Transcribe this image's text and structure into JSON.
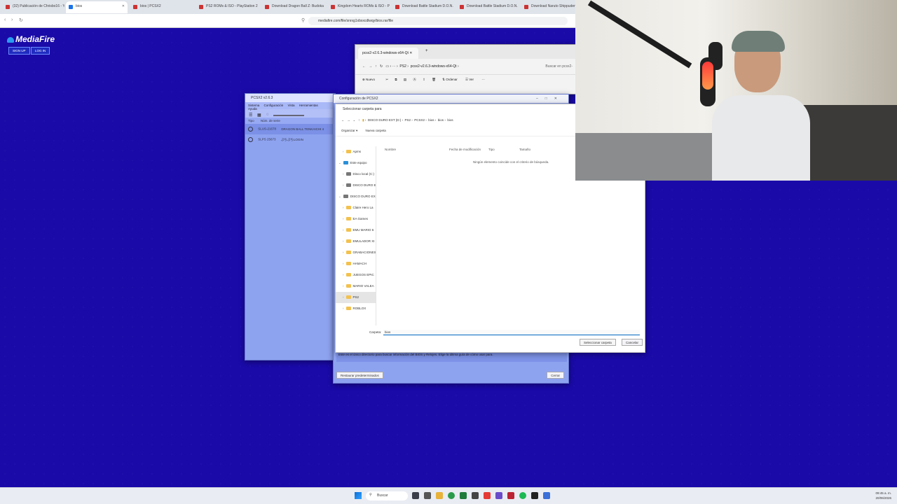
{
  "browser": {
    "tabs": [
      {
        "label": "(32) Publicación de Chrisbo16 - YouT",
        "active": false
      },
      {
        "label": "bios",
        "active": true
      },
      {
        "label": "bios | PCSX2",
        "active": false
      },
      {
        "label": "PS2 ROMs & ISO - PlayStation 2 Gam",
        "active": false
      },
      {
        "label": "Download Dragon Ball Z: Budokai Te",
        "active": false
      },
      {
        "label": "Kingdom Hearts ROMs & ISO - PS2 G",
        "active": false
      },
      {
        "label": "Download Battle Stadium D.O.N. ROM",
        "active": false
      },
      {
        "label": "Download Battle Stadium D.O.N. ROM",
        "active": false
      },
      {
        "label": "Download Naruto Shippuden Ultim",
        "active": false
      }
    ],
    "url": "mediafire.com/file/snrxg1xbxxcdlwqy/bios.rar/file"
  },
  "mediafire": {
    "logo": "MediaFire",
    "signup": "SIGN UP",
    "login": "LOG IN"
  },
  "explorer": {
    "tab_title": "pcsx2-v2.6.3-windows-x64-Qt",
    "path": [
      "PS2",
      "pcsx2-v2.6.3-windows-x64-Qt"
    ],
    "search_placeholder": "Buscar en pcsx2-",
    "toolbar": {
      "new": "Nuevo",
      "sort": "Ordenar",
      "view": "Ver"
    }
  },
  "pcsx2": {
    "title": "PCSX2 v2.6.3",
    "menu": [
      "Sistema",
      "Configuración",
      "Vista",
      "Herramientas",
      "Ayuda"
    ],
    "columns": {
      "type": "Tipo",
      "serial": "Núm. de serie"
    },
    "games": [
      {
        "serial": "SLUS-21678",
        "title": "DRAGON BALL TENKAICHI 4"
      },
      {
        "serial": "SLPS 25673",
        "title": "ぷちぷちLOGIN"
      }
    ]
  },
  "config": {
    "title": "Configuración de PCSX2",
    "description": "Este es el único directorio para buscar información del BIOS y Relojes. Elige la última guía de cómo usar para.",
    "restore": "Restaurar predeterminados",
    "close": "Cerrar"
  },
  "picker": {
    "title": "Seleccionar carpeta para",
    "path": [
      "DISCO DURO EXT (D:)",
      "PS2",
      "PCSX2",
      "bios",
      "bios",
      "bios"
    ],
    "organize": "Organizar",
    "new_folder": "Nueva carpeta",
    "columns": {
      "name": "Nombre",
      "modified": "Fecha de modificación",
      "type": "Tipo",
      "size": "Tamaño"
    },
    "empty_message": "Ningún elemento coincide con el criterio de búsqueda.",
    "nav": [
      {
        "label": "Apms",
        "type": "folder",
        "indent": 1
      },
      {
        "label": "Este equipo",
        "type": "pc",
        "indent": 0
      },
      {
        "label": "Disco local (C:)",
        "type": "drive",
        "indent": 1
      },
      {
        "label": "DISCO DURO E",
        "type": "drive",
        "indent": 1
      },
      {
        "label": "DISCO DURO EX",
        "type": "drive",
        "indent": 0
      },
      {
        "label": "Claire Hero La",
        "type": "folder",
        "indent": 1
      },
      {
        "label": "EA Games",
        "type": "folder",
        "indent": 1
      },
      {
        "label": "EMU MARIO 6",
        "type": "folder",
        "indent": 1
      },
      {
        "label": "EMULADOR XI",
        "type": "folder",
        "indent": 1
      },
      {
        "label": "GRABACIONES",
        "type": "folder",
        "indent": 1
      },
      {
        "label": "HAMACH",
        "type": "folder",
        "indent": 1
      },
      {
        "label": "JUEGOS EPIC",
        "type": "folder",
        "indent": 1
      },
      {
        "label": "MARIO VALEA",
        "type": "folder",
        "indent": 1
      },
      {
        "label": "PS2",
        "type": "folder",
        "indent": 1,
        "selected": true
      },
      {
        "label": "ROBLOX",
        "type": "folder",
        "indent": 1
      }
    ],
    "folder_label": "Carpeta:",
    "folder_value": "bios",
    "select_button": "Seleccionar carpeta",
    "cancel_button": "Cancelar"
  },
  "taskbar": {
    "search": "Buscar",
    "time": "09:45 a. m.",
    "date": "20/06/2026"
  }
}
